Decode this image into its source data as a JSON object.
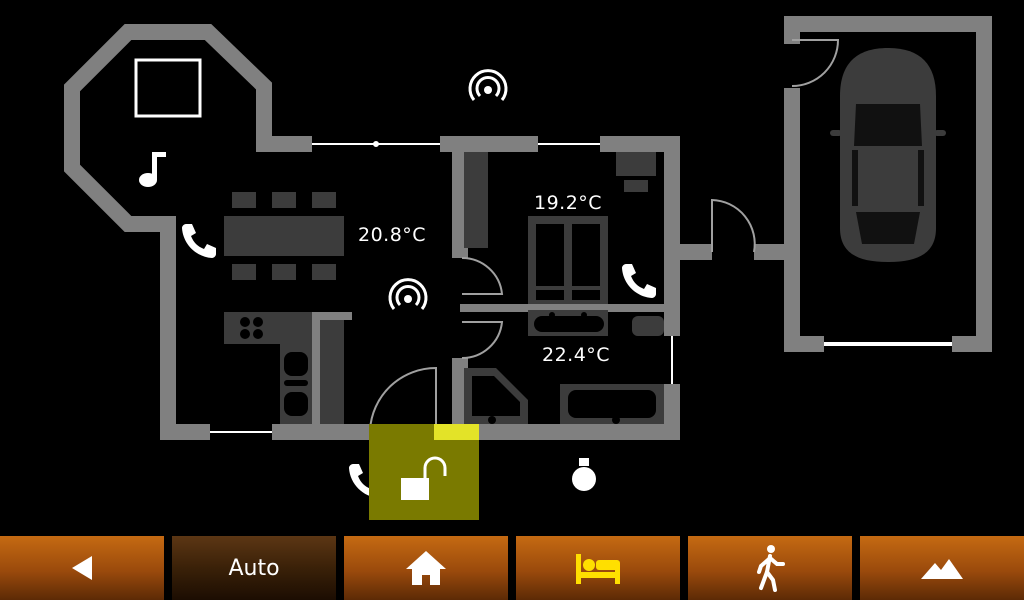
{
  "rooms": {
    "living": {
      "temperature": "20.8°C"
    },
    "bedroom": {
      "temperature": "19.2°C"
    },
    "bathroom": {
      "temperature": "22.4°C"
    }
  },
  "nav": {
    "back_icon": "back-arrow-icon",
    "mode_label": "Auto",
    "home_icon": "home-icon",
    "sleep_icon": "bed-icon",
    "away_icon": "walking-person-icon",
    "vacation_icon": "mountain-icon"
  },
  "colors": {
    "wall": "#808080",
    "furniture": "#3c3c3c",
    "lock_highlight": "#7a7a00",
    "nav_active": "#3a2108",
    "nav_button": "#9a4a0c"
  }
}
